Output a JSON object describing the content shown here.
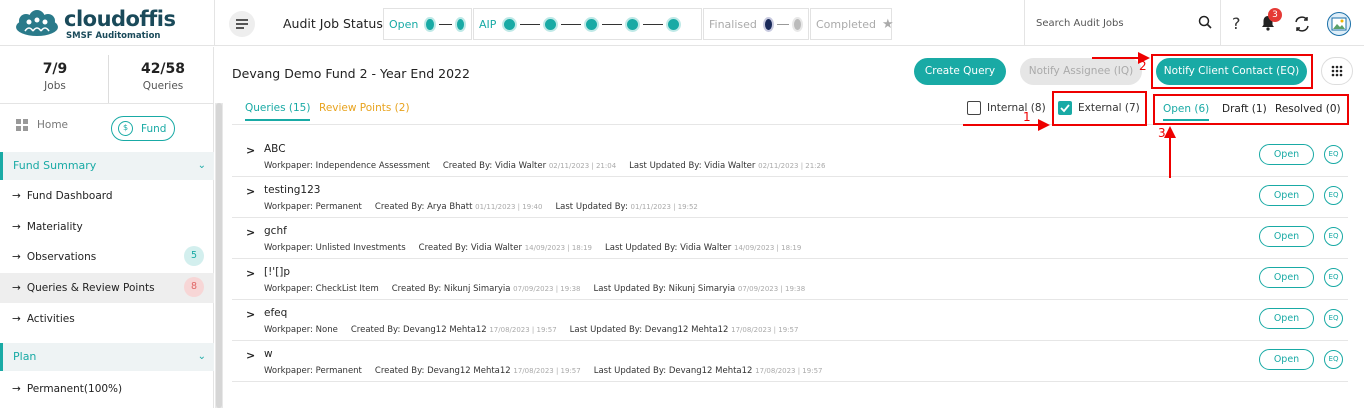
{
  "brand": {
    "name": "cloudoffis",
    "subtitle": "SMSF Auditomation"
  },
  "header": {
    "title": "Audit Job Status",
    "stages": [
      {
        "label": "Open",
        "dots": 2,
        "color": "#19aaa5"
      },
      {
        "label": "AIP",
        "dots": 5,
        "color": "#19aaa5"
      },
      {
        "label": "Finalised",
        "dots": 2,
        "color": "#1a2a5a"
      },
      {
        "label": "Completed",
        "icon": "star-icon"
      }
    ],
    "search_placeholder": "Search Audit Jobs",
    "help_label": "?",
    "notification_count": "3"
  },
  "sidebar": {
    "stats": [
      {
        "value": "7/9",
        "label": "Jobs"
      },
      {
        "value": "42/58",
        "label": "Queries"
      }
    ],
    "home_label": "Home",
    "fund_label": "Fund",
    "fund_summary": {
      "title": "Fund Summary",
      "items": [
        {
          "label": "Fund Dashboard"
        },
        {
          "label": "Materiality"
        },
        {
          "label": "Observations",
          "badge": "5"
        },
        {
          "label": "Queries & Review Points",
          "badge": "8",
          "active": true
        },
        {
          "label": "Activities"
        }
      ]
    },
    "plan": {
      "title": "Plan",
      "items": [
        {
          "label": "Permanent(100%)"
        }
      ]
    }
  },
  "main": {
    "fund_title": "Devang Demo Fund 2 - Year End 2022",
    "buttons": {
      "create_query": "Create Query",
      "notify_assignee": "Notify Assignee (IQ)",
      "notify_client": "Notify Client Contact (EQ)"
    },
    "tabs": {
      "queries": "Queries (15)",
      "review_points": "Review Points (2)"
    },
    "filters": {
      "internal": "Internal (8)",
      "external": "External (7)"
    },
    "status_tabs": {
      "open": "Open (6)",
      "draft": "Draft (1)",
      "resolved": "Resolved (0)"
    },
    "rows": [
      {
        "title": "ABC",
        "wp_label": "Workpaper:",
        "wp": "Independence Assessment",
        "cb_label": "Created By:",
        "cb": "Vidia Walter",
        "cb_date": "02/11/2023 | 21:04",
        "lu_label": "Last Updated By:",
        "lu": "Vidia Walter",
        "lu_date": "02/11/2023 | 21:26",
        "status": "Open",
        "tag": "EQ"
      },
      {
        "title": "testing123",
        "wp_label": "Workpaper:",
        "wp": "Permanent",
        "cb_label": "Created By:",
        "cb": "Arya Bhatt",
        "cb_date": "01/11/2023 | 19:40",
        "lu_label": "Last Updated By:",
        "lu": "",
        "lu_date": "01/11/2023 | 19:52",
        "status": "Open",
        "tag": "EQ"
      },
      {
        "title": "gchf",
        "wp_label": "Workpaper:",
        "wp": "Unlisted Investments",
        "cb_label": "Created By:",
        "cb": "Vidia Walter",
        "cb_date": "14/09/2023 | 18:19",
        "lu_label": "Last Updated By:",
        "lu": "Vidia Walter",
        "lu_date": "14/09/2023 | 18:19",
        "status": "Open",
        "tag": "EQ"
      },
      {
        "title": "[!'[]p",
        "wp_label": "Workpaper:",
        "wp": "CheckList Item",
        "cb_label": "Created By:",
        "cb": "Nikunj Simaryia",
        "cb_date": "07/09/2023 | 19:38",
        "lu_label": "Last Updated By:",
        "lu": "Nikunj Simaryia",
        "lu_date": "07/09/2023 | 19:38",
        "status": "Open",
        "tag": "EQ"
      },
      {
        "title": "efeq",
        "wp_label": "Workpaper:",
        "wp": "None",
        "cb_label": "Created By:",
        "cb": "Devang12 Mehta12",
        "cb_date": "17/08/2023 | 19:57",
        "lu_label": "Last Updated By:",
        "lu": "Devang12 Mehta12",
        "lu_date": "17/08/2023 | 19:57",
        "status": "Open",
        "tag": "EQ"
      },
      {
        "title": "w",
        "wp_label": "Workpaper:",
        "wp": "Permanent",
        "cb_label": "Created By:",
        "cb": "Devang12 Mehta12",
        "cb_date": "17/08/2023 | 19:57",
        "lu_label": "Last Updated By:",
        "lu": "Devang12 Mehta12",
        "lu_date": "17/08/2023 | 19:57",
        "status": "Open",
        "tag": "EQ"
      }
    ]
  },
  "annotations": {
    "one": "1",
    "two": "2",
    "three": "3",
    "color": "#e00000"
  },
  "colors": {
    "accent": "#19aaa5",
    "review": "#e8a31e",
    "badge_red": "#e53935"
  }
}
